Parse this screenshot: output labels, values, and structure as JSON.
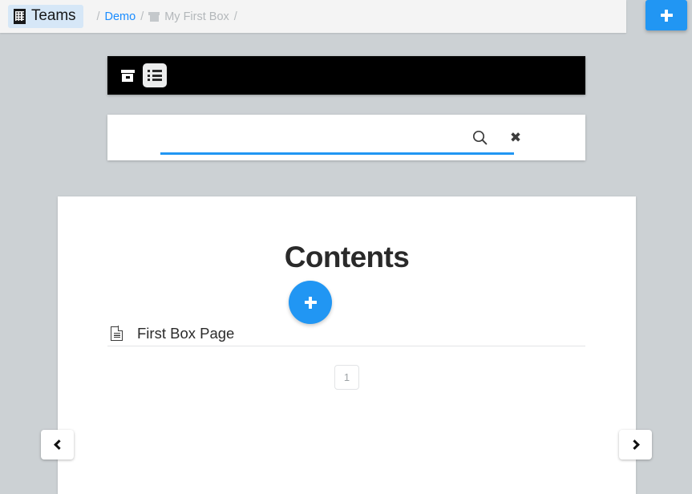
{
  "header": {
    "brand_label": "Teams",
    "brand_icon": "building-icon",
    "separator": "/",
    "breadcrumbs": [
      {
        "label": "Demo",
        "type": "link",
        "icon": null
      },
      {
        "label": "My First Box",
        "type": "muted",
        "icon": "box-icon"
      }
    ],
    "add_button_label": "+",
    "add_button_icon": "plus-icon",
    "accent_color": "#2196f3",
    "brand_chip_color": "#d6e7f7"
  },
  "toolbar": {
    "background_color": "#000000",
    "buttons": [
      {
        "name": "box-view",
        "icon": "box-icon",
        "active": false
      },
      {
        "name": "list-view",
        "icon": "list-icon",
        "active": true
      }
    ]
  },
  "search": {
    "value": "",
    "placeholder": "",
    "underline_color": "#2196f3",
    "search_icon": "search-icon",
    "clear_icon": "close-icon",
    "clear_glyph": "✖"
  },
  "main": {
    "title": "Contents",
    "add_page_icon": "plus-icon",
    "add_page_color": "#2196f3",
    "pages": [
      {
        "icon": "document-icon",
        "title": "First Box Page"
      }
    ],
    "pagination": {
      "pages": [
        "1"
      ],
      "current": "1"
    }
  },
  "nav": {
    "prev_label": "‹",
    "prev_icon": "chevron-left-icon",
    "next_label": "›",
    "next_icon": "chevron-right-icon"
  },
  "background_color": "#ccd1d4"
}
